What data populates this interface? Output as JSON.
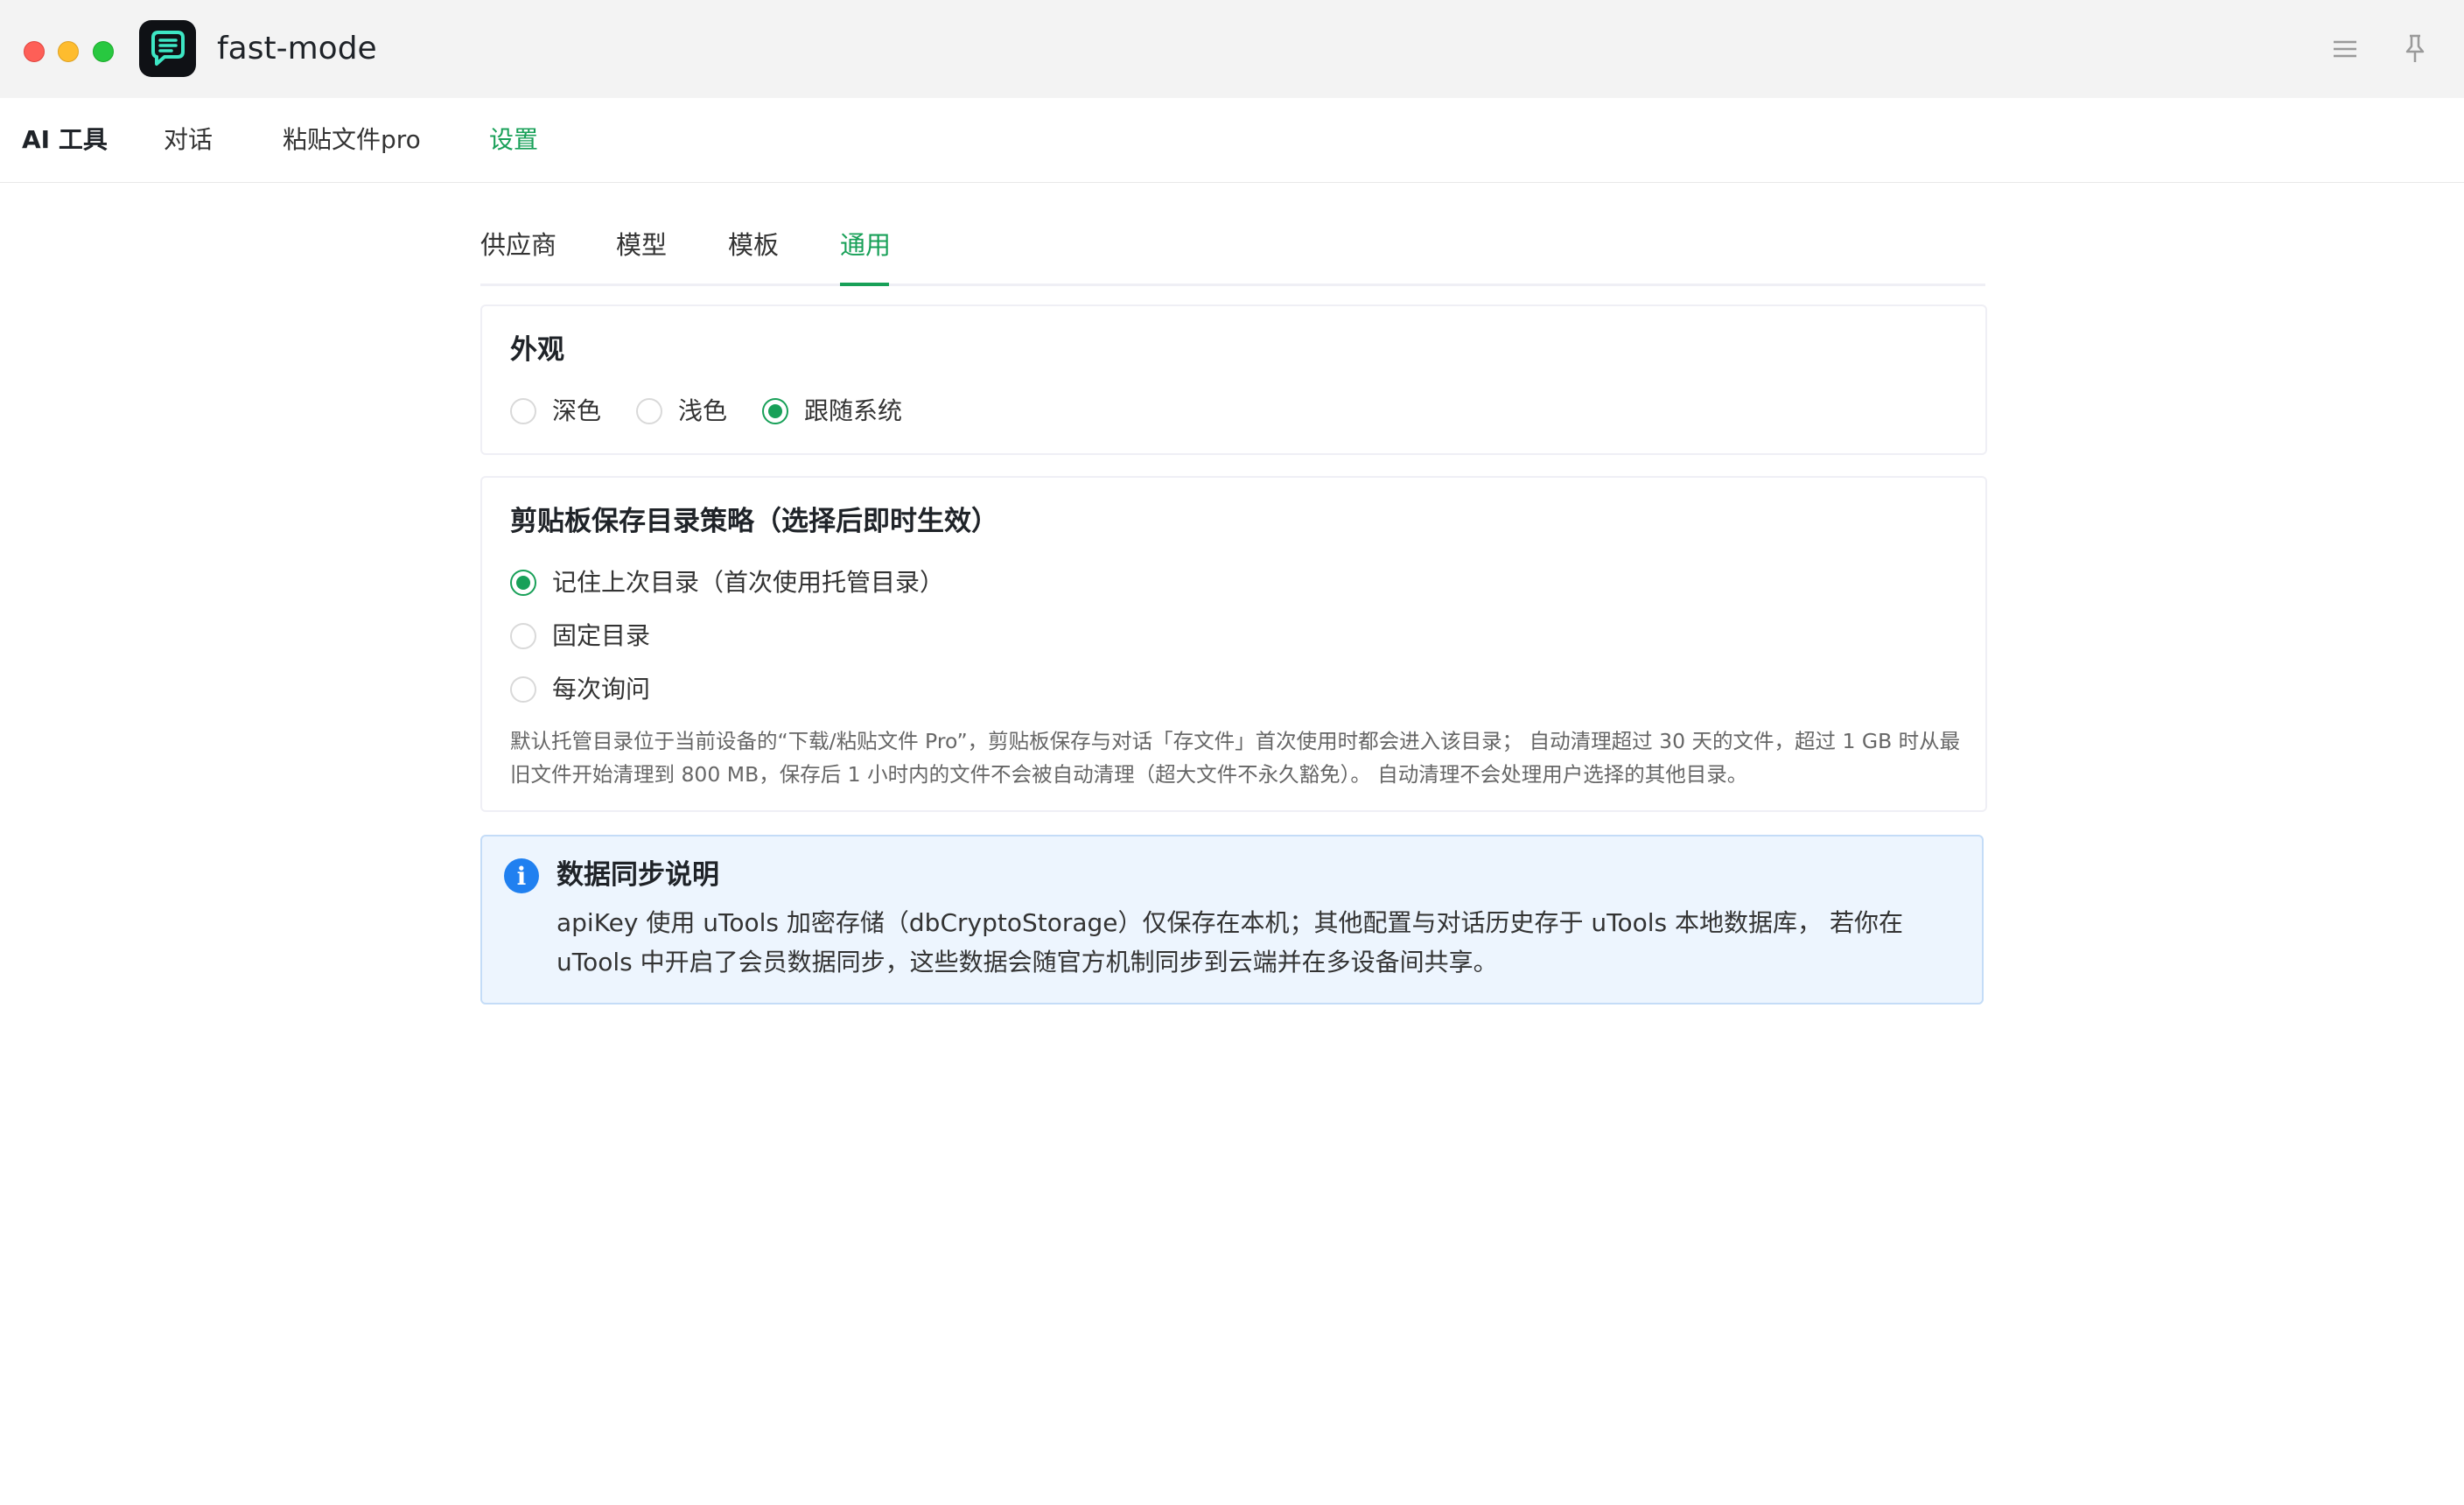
{
  "window": {
    "title": "fast-mode"
  },
  "topnav": {
    "brand": "AI 工具",
    "items": [
      {
        "label": "对话"
      },
      {
        "label": "粘贴文件pro"
      },
      {
        "label": "设置"
      }
    ],
    "active": "设置"
  },
  "tabs": {
    "items": [
      {
        "label": "供应商"
      },
      {
        "label": "模型"
      },
      {
        "label": "模板"
      },
      {
        "label": "通用"
      }
    ],
    "active": "通用"
  },
  "appearance": {
    "title": "外观",
    "options": [
      {
        "label": "深色",
        "checked": false
      },
      {
        "label": "浅色",
        "checked": false
      },
      {
        "label": "跟随系统",
        "checked": true
      }
    ]
  },
  "clipboard": {
    "title": "剪贴板保存目录策略（选择后即时生效）",
    "options": [
      {
        "label": "记住上次目录（首次使用托管目录）",
        "checked": true
      },
      {
        "label": "固定目录",
        "checked": false
      },
      {
        "label": "每次询问",
        "checked": false
      }
    ],
    "hint": "默认托管目录位于当前设备的“下载/粘贴文件 Pro”，剪贴板保存与对话「存文件」首次使用时都会进入该目录； 自动清理超过 30 天的文件，超过 1 GB 时从最旧文件开始清理到 800 MB，保存后 1 小时内的文件不会被自动清理（超大文件不永久豁免）。 自动清理不会处理用户选择的其他目录。"
  },
  "info": {
    "icon": "i",
    "title": "数据同步说明",
    "body": "apiKey 使用 uTools 加密存储（dbCryptoStorage）仅保存在本机；其他配置与对话历史存于 uTools 本地数据库， 若你在 uTools 中开启了会员数据同步，这些数据会随官方机制同步到云端并在多设备间共享。"
  },
  "colors": {
    "accent": "#18a058",
    "info": "#2080f0",
    "info_bg": "#edf5fe"
  },
  "icons": {
    "menu": "hamburger-menu-icon",
    "pin": "pin-icon",
    "app": "chat-bubble-app-icon"
  }
}
